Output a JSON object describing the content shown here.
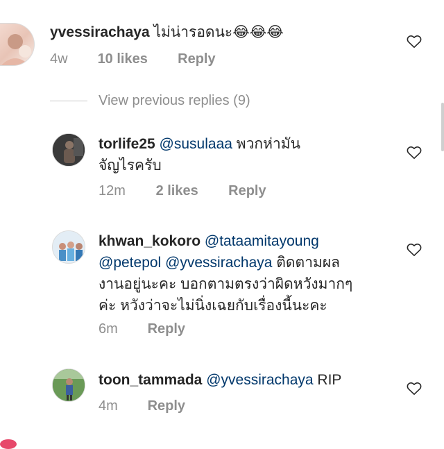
{
  "comments": [
    {
      "username": "yvessirachaya",
      "text": "ไม่น่ารอดนะ😂😂😂",
      "time": "4w",
      "likes": "10 likes",
      "reply": "Reply"
    },
    {
      "username": "torlife25",
      "mention": "@susulaaa",
      "text_line1": "พวกห่ามัน",
      "text_line2": "จัญไรครับ",
      "time": "12m",
      "likes": "2 likes",
      "reply": "Reply"
    },
    {
      "username": "khwan_kokoro",
      "mention1": "@tataamitayoung",
      "mention2": "@petepol",
      "mention3": "@yvessirachaya",
      "text_line2": "ติดตามผล",
      "text_line3": "งานอยู่นะคะ บอกตามตรงว่าผิดหวังมากๆ",
      "text_line4": "ค่ะ หวังว่าจะไม่นิ่งเฉยกับเรื่องนี้นะคะ",
      "time": "6m",
      "reply": "Reply"
    },
    {
      "username": "toon_tammada",
      "mention": "@yvessirachaya",
      "text": "RIP",
      "time": "4m",
      "reply": "Reply"
    }
  ],
  "view_previous": "View previous replies (9)",
  "icons": {
    "like": "heart-outline-icon"
  },
  "colors": {
    "username": "#262626",
    "mention": "#00376b",
    "meta": "#8e8e8e"
  }
}
